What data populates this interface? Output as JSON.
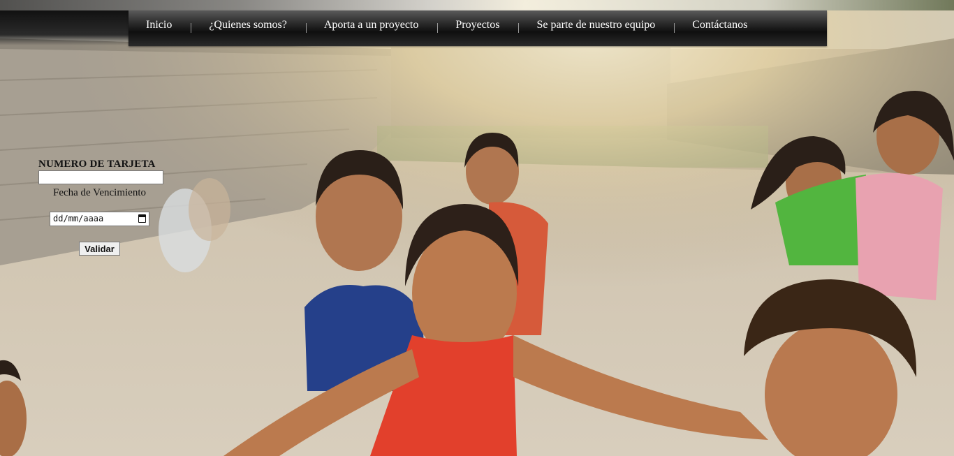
{
  "nav": {
    "items": [
      {
        "label": "Inicio"
      },
      {
        "label": "¿Quienes somos?"
      },
      {
        "label": "Aporta a un proyecto"
      },
      {
        "label": "Proyectos"
      },
      {
        "label": "Se parte de nuestro equipo"
      },
      {
        "label": "Contáctanos"
      }
    ]
  },
  "form": {
    "card_label": "NUMERO DE TARJETA",
    "card_value": "",
    "expiry_label": "Fecha de Vencimiento",
    "expiry_placeholder": "dd/mm/aaaa",
    "submit_label": "Validar"
  },
  "icons": {
    "calendar": "calendar-icon"
  },
  "colors": {
    "nav_bg": "#1a1a1a",
    "nav_text": "#ffffff"
  }
}
